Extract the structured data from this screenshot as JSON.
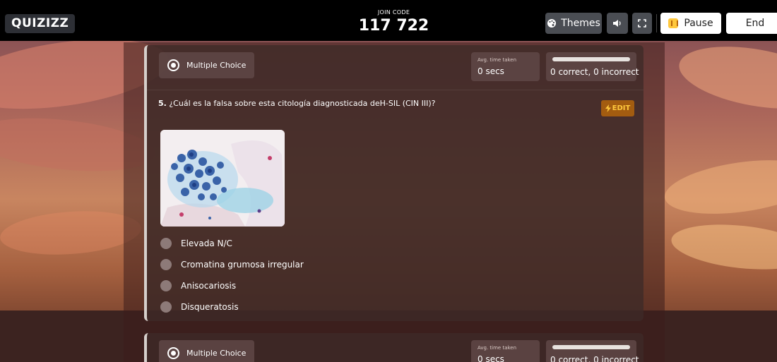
{
  "app": {
    "logo": "QUIZIZZ",
    "join_label": "JOIN CODE",
    "join_code": "117 722",
    "themes_label": "Themes",
    "pause_label": "Pause",
    "end_label": "End",
    "icons": {
      "themes": "palette-icon",
      "sound": "speaker-icon",
      "fullscreen": "fullscreen-icon",
      "pause": "pause-icon",
      "edit": "lightning-icon"
    },
    "colors": {
      "topbar": "#000000",
      "pause_icon": "#ffc83d",
      "edit_bg": "#a35c10",
      "edit_text": "#ffc83d"
    }
  },
  "questions": [
    {
      "type_label": "Multiple Choice",
      "avg_label": "Avg. time taken",
      "avg_value": "0 secs",
      "accuracy_text": "0 correct, 0 incorrect",
      "number": "5.",
      "text": "¿Cuál es la falsa sobre esta citología diagnosticada deH-SIL (CIN III)?",
      "edit_label": "EDIT",
      "options": [
        "Elevada N/C",
        "Cromatina grumosa irregular",
        "Anisocariosis",
        "Disqueratosis"
      ]
    },
    {
      "type_label": "Multiple Choice",
      "avg_label": "Avg. time taken",
      "avg_value": "0 secs",
      "accuracy_text": "0 correct, 0 incorrect"
    }
  ]
}
